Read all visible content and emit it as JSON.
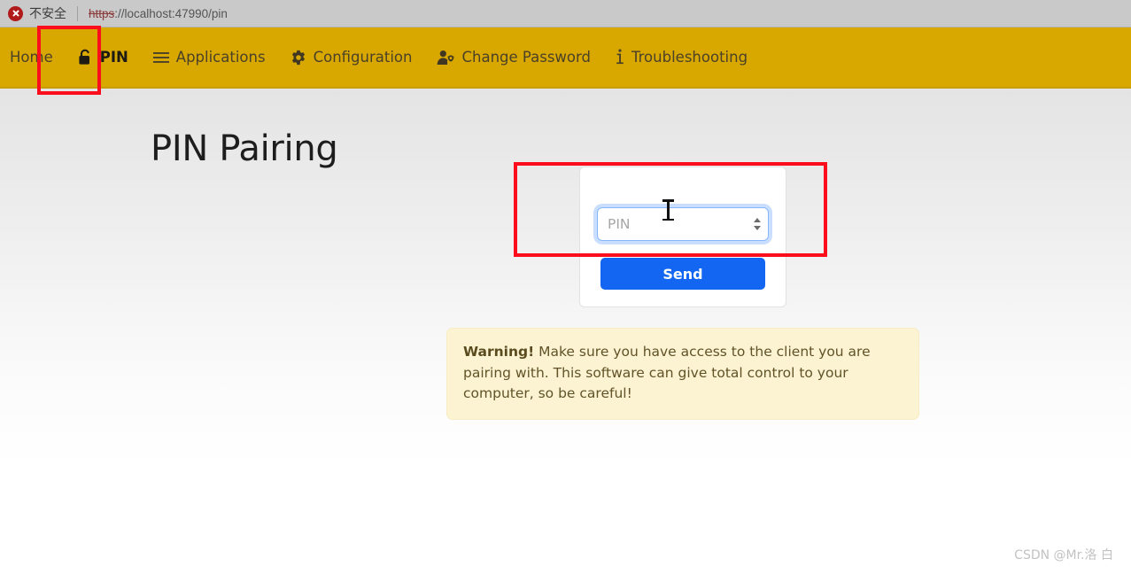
{
  "browser": {
    "security_label": "不安全",
    "url_scheme": "https",
    "url_rest": "://localhost:47990/pin",
    "not_secure_icon": "circle-x-icon"
  },
  "navbar": {
    "background": "#d9a800",
    "items": [
      {
        "label": "Home",
        "icon": "",
        "active": false
      },
      {
        "label": "PIN",
        "icon": "unlock-icon",
        "active": true
      },
      {
        "label": "Applications",
        "icon": "list-icon",
        "active": false
      },
      {
        "label": "Configuration",
        "icon": "gear-icon",
        "active": false
      },
      {
        "label": "Change Password",
        "icon": "person-shield-icon",
        "active": false
      },
      {
        "label": "Troubleshooting",
        "icon": "info-icon",
        "active": false
      }
    ]
  },
  "page": {
    "title": "PIN Pairing"
  },
  "pairing_form": {
    "pin_placeholder": "PIN",
    "pin_value": "",
    "spinner_up": "spinner-up-icon",
    "spinner_down": "spinner-down-icon",
    "send_label": "Send",
    "send_color": "#1266f1"
  },
  "warning": {
    "strong": "Warning!",
    "text": " Make sure you have access to the client you are pairing with. This software can give total control to your computer, so be careful!",
    "background": "#fcf3d3"
  },
  "annotations": {
    "color": "#fc0d1b",
    "boxes": [
      "pin-nav-item",
      "pin-input-area"
    ]
  },
  "watermark": {
    "text": "CSDN @Mr.洛 白"
  }
}
